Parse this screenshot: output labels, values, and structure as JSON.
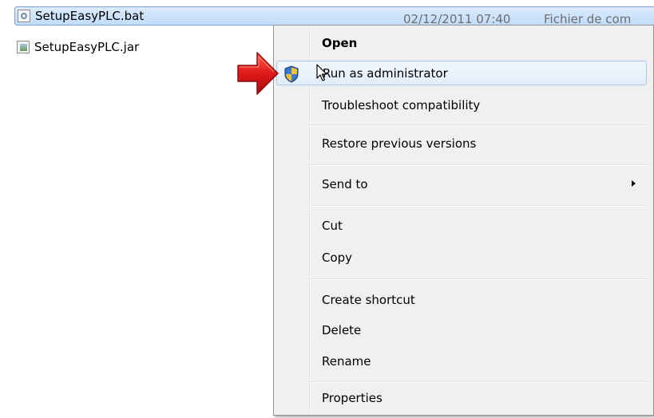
{
  "files": [
    {
      "name": "SetupEasyPLC.bat",
      "date": "02/12/2011 07:40",
      "type": "Fichier de com",
      "selected": true,
      "icon": "batch-file-icon"
    },
    {
      "name": "SetupEasyPLC.jar",
      "icon": "jar-file-icon"
    }
  ],
  "context_menu": {
    "items": [
      {
        "label": "Open",
        "bold": true
      },
      {
        "label": "Run as administrator",
        "icon": "uac-shield-icon",
        "highlighted": true
      },
      {
        "label": "Troubleshoot compatibility"
      },
      {
        "label": "Restore previous versions"
      },
      {
        "label": "Send to",
        "has_submenu": true
      },
      {
        "label": "Cut"
      },
      {
        "label": "Copy"
      },
      {
        "label": "Create shortcut"
      },
      {
        "label": "Delete"
      },
      {
        "label": "Rename"
      },
      {
        "label": "Properties"
      }
    ]
  },
  "annotation": {
    "pointer": "red-arrow-icon",
    "color": "#e0191a"
  },
  "colors": {
    "selection": "#c1dcfb",
    "hover_border": "#a8c8ec",
    "menu_bg": "#f0f0f0"
  }
}
